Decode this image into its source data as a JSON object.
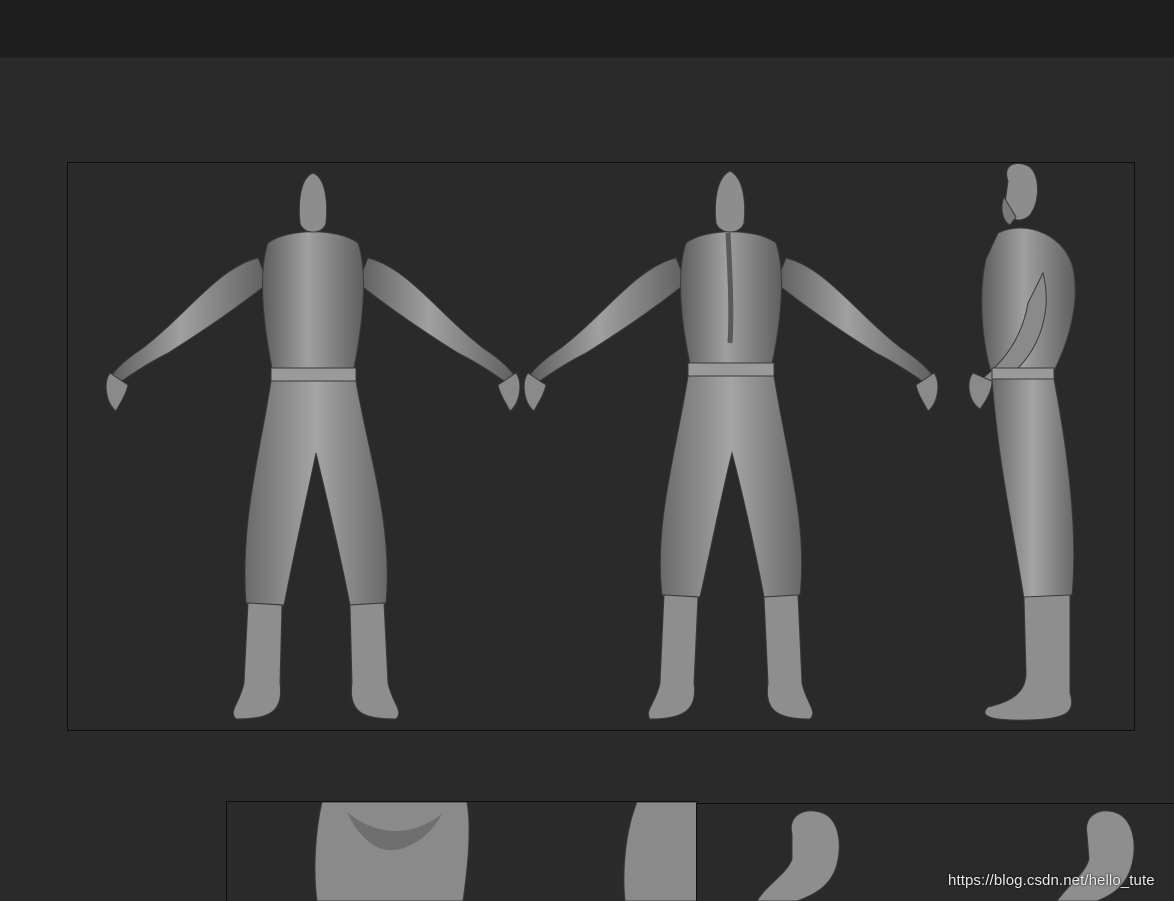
{
  "watermark": {
    "text": "https://blog.csdn.net/hello_tute"
  },
  "colors": {
    "background": "#2b2b2b",
    "topbar": "#1f1f1f",
    "frame_border": "#0e0e0e",
    "sculpt_gray": "#8e8e8e"
  },
  "panels": [
    {
      "name": "main-turnaround-panel",
      "views": [
        "front-view",
        "back-view",
        "side-view"
      ]
    },
    {
      "name": "head-detail-panel",
      "views": [
        "head-detail-left",
        "head-detail-right"
      ]
    },
    {
      "name": "face-detail-panel",
      "views": [
        "face-detail-left",
        "face-detail-right"
      ]
    }
  ]
}
